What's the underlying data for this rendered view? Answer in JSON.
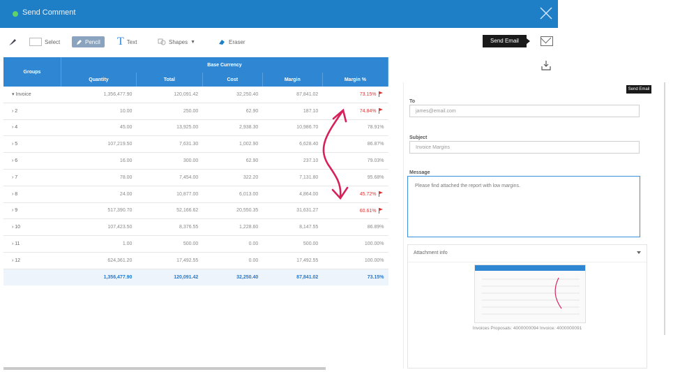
{
  "window": {
    "title": "Send Comment"
  },
  "toolbar": {
    "select": "Select",
    "pencil": "Pencil",
    "text": "Text",
    "shapes": "Shapes",
    "eraser": "Eraser",
    "send_email": "Send Email"
  },
  "table": {
    "groups_header": "Groups",
    "base_currency": "Base Currency",
    "columns": [
      "Quantity",
      "Total",
      "Cost",
      "Margin",
      "Margin %"
    ],
    "rows": [
      {
        "group": "Invoice",
        "quantity": "1,356,477.90",
        "total": "120,091.42",
        "cost": "32,250.40",
        "margin": "87,841.02",
        "margin_pct": "73.15%",
        "flag": true,
        "red": true
      },
      {
        "group": "2",
        "quantity": "10.00",
        "total": "250.00",
        "cost": "62.90",
        "margin": "187.10",
        "margin_pct": "74.84%",
        "flag": true,
        "red": true
      },
      {
        "group": "4",
        "quantity": "45.00",
        "total": "13,925.00",
        "cost": "2,938.30",
        "margin": "10,986.70",
        "margin_pct": "78.91%",
        "flag": false,
        "red": false
      },
      {
        "group": "5",
        "quantity": "107,219.50",
        "total": "7,631.30",
        "cost": "1,002.90",
        "margin": "6,628.40",
        "margin_pct": "86.87%",
        "flag": false,
        "red": false
      },
      {
        "group": "6",
        "quantity": "16.00",
        "total": "300.00",
        "cost": "62.90",
        "margin": "237.10",
        "margin_pct": "79.03%",
        "flag": false,
        "red": false
      },
      {
        "group": "7",
        "quantity": "78.00",
        "total": "7,454.00",
        "cost": "322.20",
        "margin": "7,131.80",
        "margin_pct": "95.68%",
        "flag": false,
        "red": false
      },
      {
        "group": "8",
        "quantity": "24.00",
        "total": "10,877.00",
        "cost": "6,013.00",
        "margin": "4,864.00",
        "margin_pct": "45.72%",
        "flag": true,
        "red": true
      },
      {
        "group": "9",
        "quantity": "517,390.70",
        "total": "52,166.62",
        "cost": "20,550.35",
        "margin": "31,631.27",
        "margin_pct": "60.61%",
        "flag": true,
        "red": true
      },
      {
        "group": "10",
        "quantity": "107,423.50",
        "total": "8,376.55",
        "cost": "1,228.60",
        "margin": "8,147.55",
        "margin_pct": "86.89%",
        "flag": false,
        "red": false
      },
      {
        "group": "11",
        "quantity": "1.00",
        "total": "500.00",
        "cost": "0.00",
        "margin": "500.00",
        "margin_pct": "100.00%",
        "flag": false,
        "red": false
      },
      {
        "group": "12",
        "quantity": "624,361.20",
        "total": "17,492.55",
        "cost": "0.00",
        "margin": "17,492.55",
        "margin_pct": "100.00%",
        "flag": false,
        "red": false
      }
    ],
    "totals": {
      "quantity": "1,356,477.90",
      "total": "120,091.42",
      "cost": "32,250.40",
      "margin": "87,841.02",
      "margin_pct": "73.15%"
    }
  },
  "email_panel": {
    "to_label": "To",
    "to_value": "james@email.com",
    "subject_label": "Subject",
    "subject_value": "Invoice Margins",
    "message_label": "Message",
    "message_value": "Please find attached the report with low margins.",
    "attachment_label": "Attachment info",
    "attachment_caption": "Invoices Proposals: 4000000094 Invoice: 4000000091",
    "send_email_small": "Send Email"
  },
  "colors": {
    "header_blue": "#1f7fc6",
    "table_blue": "#2f86d3",
    "warn_red": "#d23a3a"
  }
}
